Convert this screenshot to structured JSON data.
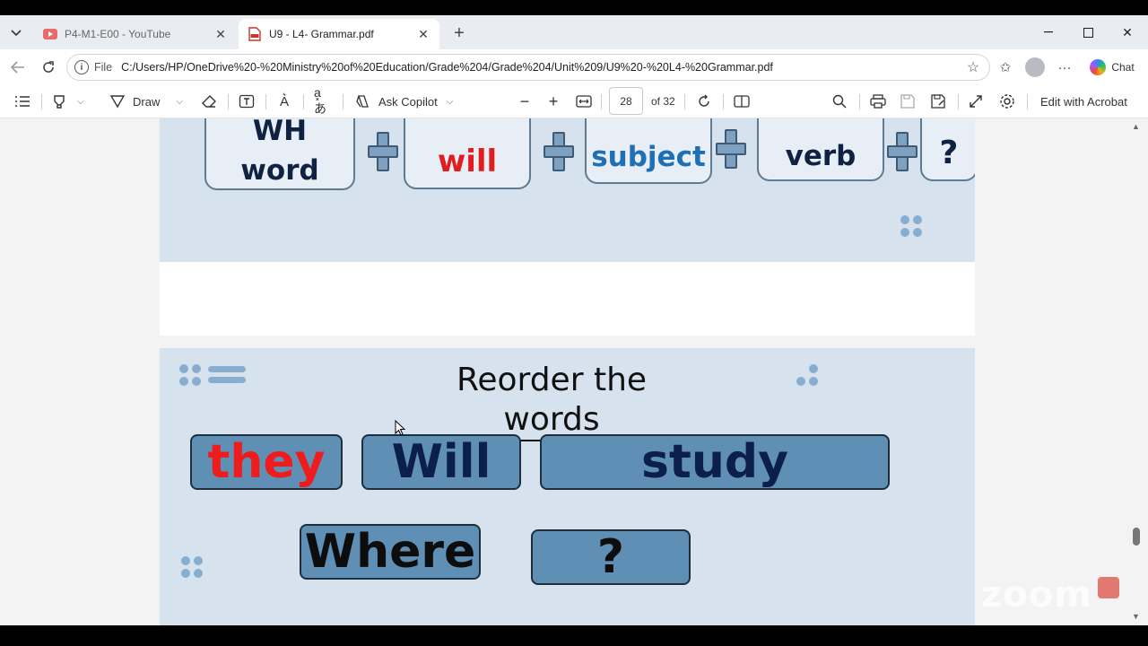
{
  "browser": {
    "tabs": [
      {
        "title": "P4-M1-E00 - YouTube",
        "icon": "youtube-icon",
        "active": false
      },
      {
        "title": "U9 - L4- Grammar.pdf",
        "icon": "pdf-icon",
        "active": true
      }
    ],
    "address": {
      "scheme": "File",
      "url": "C:/Users/HP/OneDrive%20-%20Ministry%20of%20Education/Grade%204/Grade%204/Unit%209/U9%20-%20L4-%20Grammar.pdf"
    },
    "chat_label": "Chat"
  },
  "pdf_toolbar": {
    "draw_label": "Draw",
    "copilot_label": "Ask Copilot",
    "page_number": "28",
    "page_count": "of 32",
    "edit_label": "Edit with Acrobat"
  },
  "page1": {
    "formula": [
      {
        "line1": "WH",
        "line2": "word",
        "color": "#0f2242"
      },
      {
        "text": "will",
        "color": "#e11d1d"
      },
      {
        "text": "subject",
        "color": "#1f6fb5"
      },
      {
        "text": "verb",
        "color": "#0f2242"
      },
      {
        "text": "?",
        "color": "#0f2242"
      }
    ]
  },
  "page2": {
    "title": "Reorder the words",
    "words": [
      {
        "text": "they",
        "color": "#ee1c1c"
      },
      {
        "text": "Will",
        "color": "#0b1f4a"
      },
      {
        "text": "study",
        "color": "#0b1f4a"
      },
      {
        "text": "Where",
        "color": "#0d0d0d"
      },
      {
        "text": "?",
        "color": "#0d0d0d"
      }
    ]
  },
  "watermark": "zoom",
  "colors": {
    "slide_background": "#d6e3ee",
    "word_card": "#5f8fb5"
  }
}
